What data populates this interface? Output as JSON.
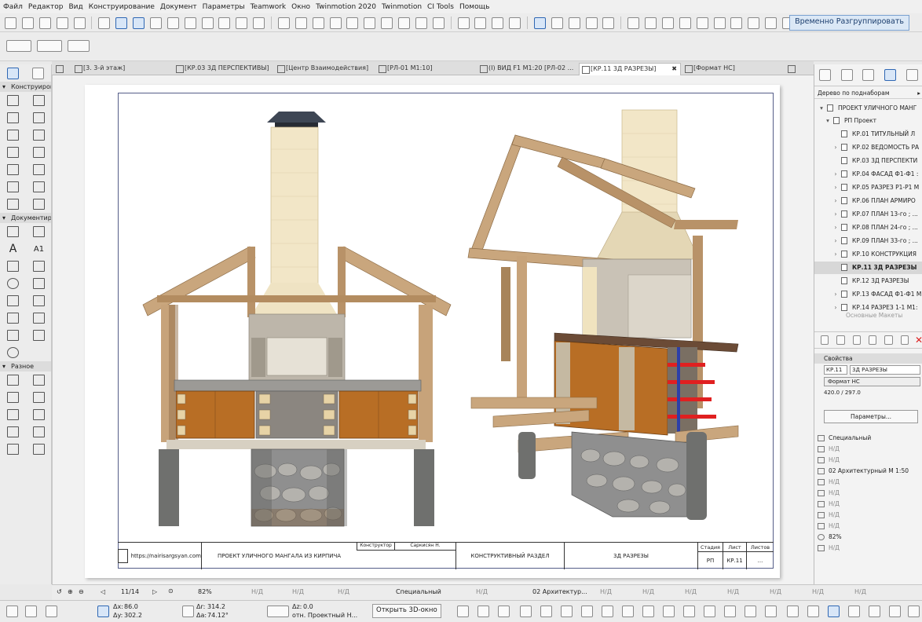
{
  "menu": [
    "Файл",
    "Редактор",
    "Вид",
    "Конструирование",
    "Документ",
    "Параметры",
    "Teamwork",
    "Окно",
    "Twinmotion 2020",
    "Twinmotion",
    "CI Tools",
    "Помощь"
  ],
  "toolbar": {
    "regroup_label": "Временно Разгруппировать"
  },
  "toolbox": {
    "sec_construct": "Конструирова",
    "sec_document": "Документиро",
    "sec_misc": "Разное",
    "text_tool_a": "A",
    "text_tool_a1": "A1"
  },
  "tabs": [
    "[3. 3-й этаж]",
    "[КР.03 3Д ПЕРСПЕКТИВЫ]",
    "[Центр Взаимодействия]",
    "[РЛ-01 М1:10]",
    "(I) ВИД F1 М1:20 [РЛ-02 ...",
    "[КР.11 3Д РАЗРЕЗЫ]",
    "[Формат НС]"
  ],
  "tab_close": "✖",
  "stamp": {
    "site": "https://nairisargsyan.com",
    "project": "ПРОЕКТ УЛИЧНОГО МАНГАЛА ИЗ КИРПИЧА",
    "role": "Конструктор",
    "person": "Саркисян Н.",
    "section": "КОНСТРУКТИВНЫЙ РАЗДЕЛ",
    "sheet_title": "3Д РАЗРЕЗЫ",
    "col_stage": "Стадия",
    "col_sheet": "Лист",
    "col_sheets": "Листов",
    "stage": "РП",
    "sheet": "КР.11",
    "sheets": "..."
  },
  "rpanel": {
    "tree_header": "Дерево по поднаборам",
    "root": "ПРОЕКТ УЛИЧНОГО МАНГ",
    "subset": "РП Проект",
    "items": [
      "КР.01 ТИТУЛЬНЫЙ Л",
      "КР.02 ВЕДОМОСТЬ РА",
      "КР.03 3Д ПЕРСПЕКТИ",
      "КР.04 ФАСАД Ф1-Ф1 :",
      "КР.05 РАЗРЕЗ Р1-Р1 М",
      "КР.06 ПЛАН АРМИРО",
      "КР.07  ПЛАН 13-го ; ...",
      "КР.08  ПЛАН 24-го ; ...",
      "КР.09  ПЛАН 33-го ; ...",
      "КР.10 КОНСТРУКЦИЯ",
      "КР.11 3Д РАЗРЕЗЫ",
      "КР.12 3Д РАЗРЕЗЫ",
      "КР.13 ФАСАД Ф1-Ф1 М",
      "КР.14 РАЗРЕЗ 1-1 М1:"
    ],
    "partial": "Основные Макеты",
    "props_header": "Свойства",
    "prop_id": "КР.11",
    "prop_name": "3Д РАЗРЕЗЫ",
    "prop_format": "Формат НС",
    "prop_size": "420.0 / 297.0",
    "params_button": "Параметры...",
    "list": [
      "Специальный",
      "Н/Д",
      "Н/Д",
      "02 Архитектурный М 1:50",
      "Н/Д",
      "Н/Д",
      "Н/Д",
      "Н/Д",
      "Н/Д",
      "82%",
      "Н/Д"
    ]
  },
  "status": {
    "page": "11/14",
    "zoom": "82%",
    "na": "Н/Д",
    "layer": "Специальный",
    "pen": "02 Архитектур...",
    "dx_label": "Δx:",
    "dx": "86.0",
    "dy_label": "Δy:",
    "dy": "302.2",
    "dr_label": "Δr:",
    "dr": "314.2",
    "da_label": "Δa:",
    "da": "74.12°",
    "dz_label": "Δz:",
    "dz": "0.0",
    "ref": "отн. Проектный Н...",
    "open3d": "Открыть 3D-окно"
  }
}
